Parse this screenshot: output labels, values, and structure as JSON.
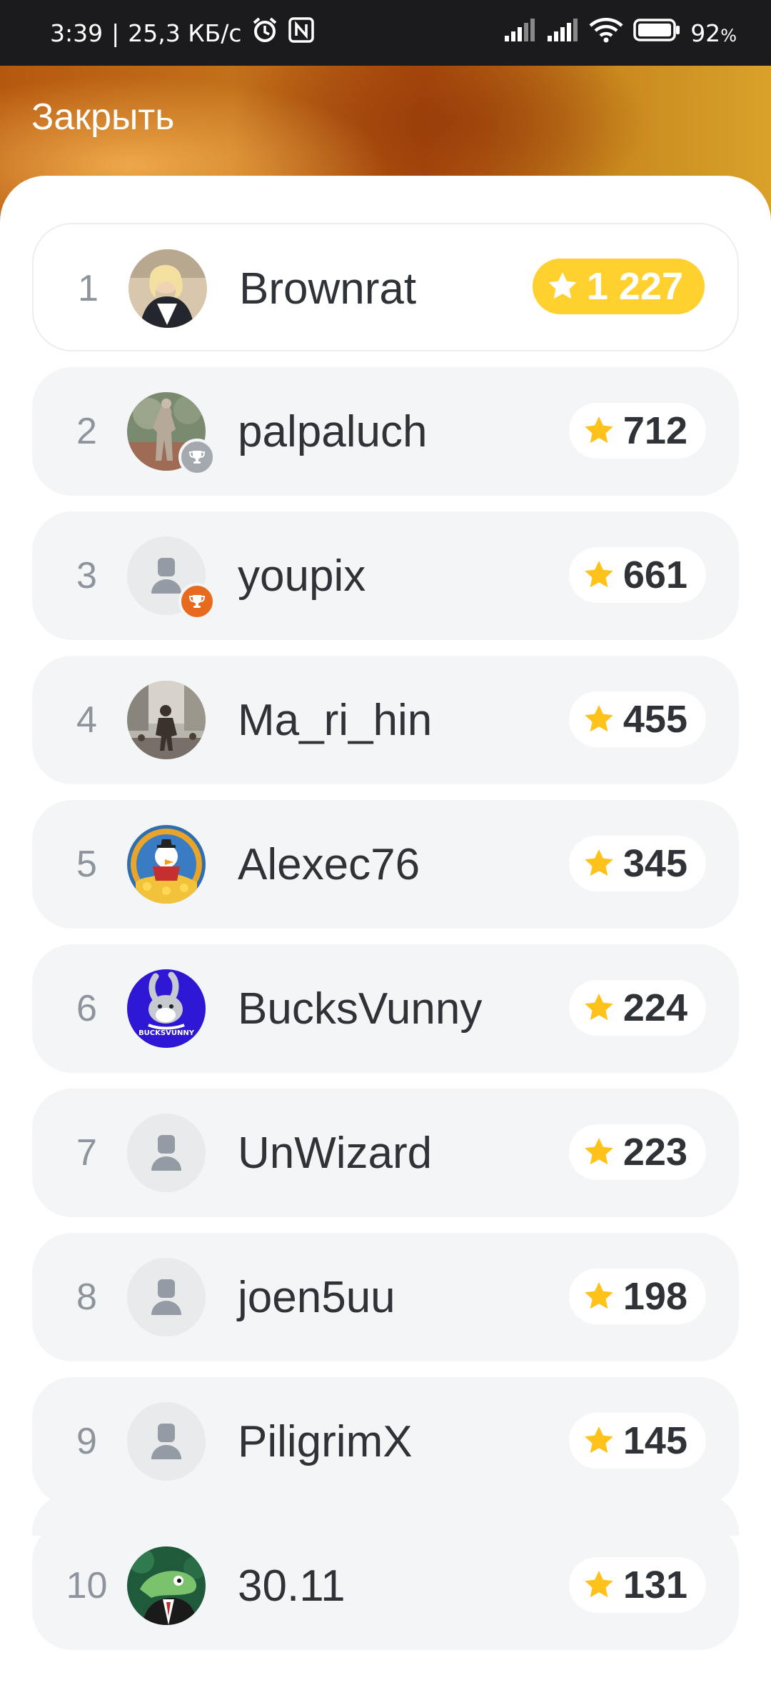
{
  "status_bar": {
    "time": "3:39",
    "speed": "25,3 КБ/с",
    "battery": "92",
    "battery_unit": "%"
  },
  "header": {
    "close_label": "Закрыть"
  },
  "colors": {
    "gold": "#ffd02e",
    "star": "#ffc21a",
    "silver": "#a4a9af",
    "bronze": "#e86a1e"
  },
  "leaderboard": [
    {
      "rank": "1",
      "name": "Brownrat",
      "score": "1 227",
      "avatar": "photo-woman",
      "highlight": true,
      "badge": "none"
    },
    {
      "rank": "2",
      "name": "palpaluch",
      "score": "712",
      "avatar": "photo-statue",
      "highlight": false,
      "badge": "silver-trophy"
    },
    {
      "rank": "3",
      "name": "youpix",
      "score": "661",
      "avatar": "default-user",
      "highlight": false,
      "badge": "bronze-trophy"
    },
    {
      "rank": "4",
      "name": "Ma_ri_hin",
      "score": "455",
      "avatar": "photo-girl-statue",
      "highlight": false,
      "badge": "none"
    },
    {
      "rank": "5",
      "name": "Alexec76",
      "score": "345",
      "avatar": "cartoon-duck-coins",
      "highlight": false,
      "badge": "none"
    },
    {
      "rank": "6",
      "name": "BucksVunny",
      "score": "224",
      "avatar": "cartoon-bunny",
      "avatar_text": "BUCKSVUNNY",
      "highlight": false,
      "badge": "none"
    },
    {
      "rank": "7",
      "name": "UnWizard",
      "score": "223",
      "avatar": "default-user",
      "highlight": false,
      "badge": "none"
    },
    {
      "rank": "8",
      "name": "joen5uu",
      "score": "198",
      "avatar": "default-user",
      "highlight": false,
      "badge": "none"
    },
    {
      "rank": "9",
      "name": "PiligrimX",
      "score": "145",
      "avatar": "default-user",
      "highlight": false,
      "badge": "none"
    },
    {
      "rank": "10",
      "name": "30.11",
      "score": "131",
      "avatar": "cartoon-lizard",
      "highlight": false,
      "badge": "none"
    }
  ]
}
